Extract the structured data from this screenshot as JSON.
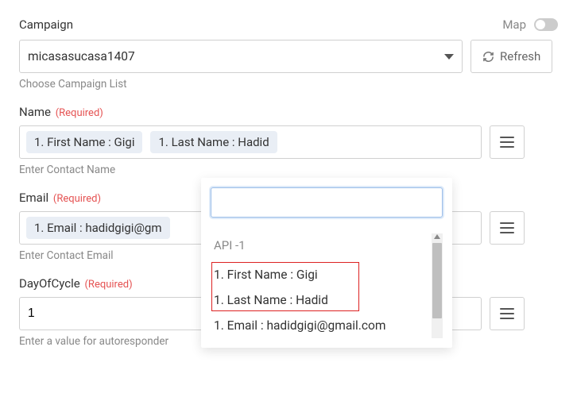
{
  "campaign": {
    "label": "Campaign",
    "map_label": "Map",
    "selected": "micasasucasa1407",
    "refresh": "Refresh",
    "hint": "Choose Campaign List"
  },
  "name_field": {
    "label": "Name",
    "required": "(Required)",
    "chips": [
      "1. First Name : Gigi",
      "1. Last Name : Hadid"
    ],
    "hint": "Enter Contact Name"
  },
  "email_field": {
    "label": "Email",
    "required": "(Required)",
    "chips": [
      "1. Email : hadidgigi@gm"
    ],
    "hint": "Enter Contact Email"
  },
  "day_field": {
    "label": "DayOfCycle",
    "required": "(Required)",
    "value": "1",
    "hint": "Enter a value for autoresponder"
  },
  "popup": {
    "group": "API -1",
    "items": [
      "1. First Name : Gigi",
      "1. Last Name : Hadid",
      "1. Email : hadidgigi@gmail.com"
    ]
  }
}
